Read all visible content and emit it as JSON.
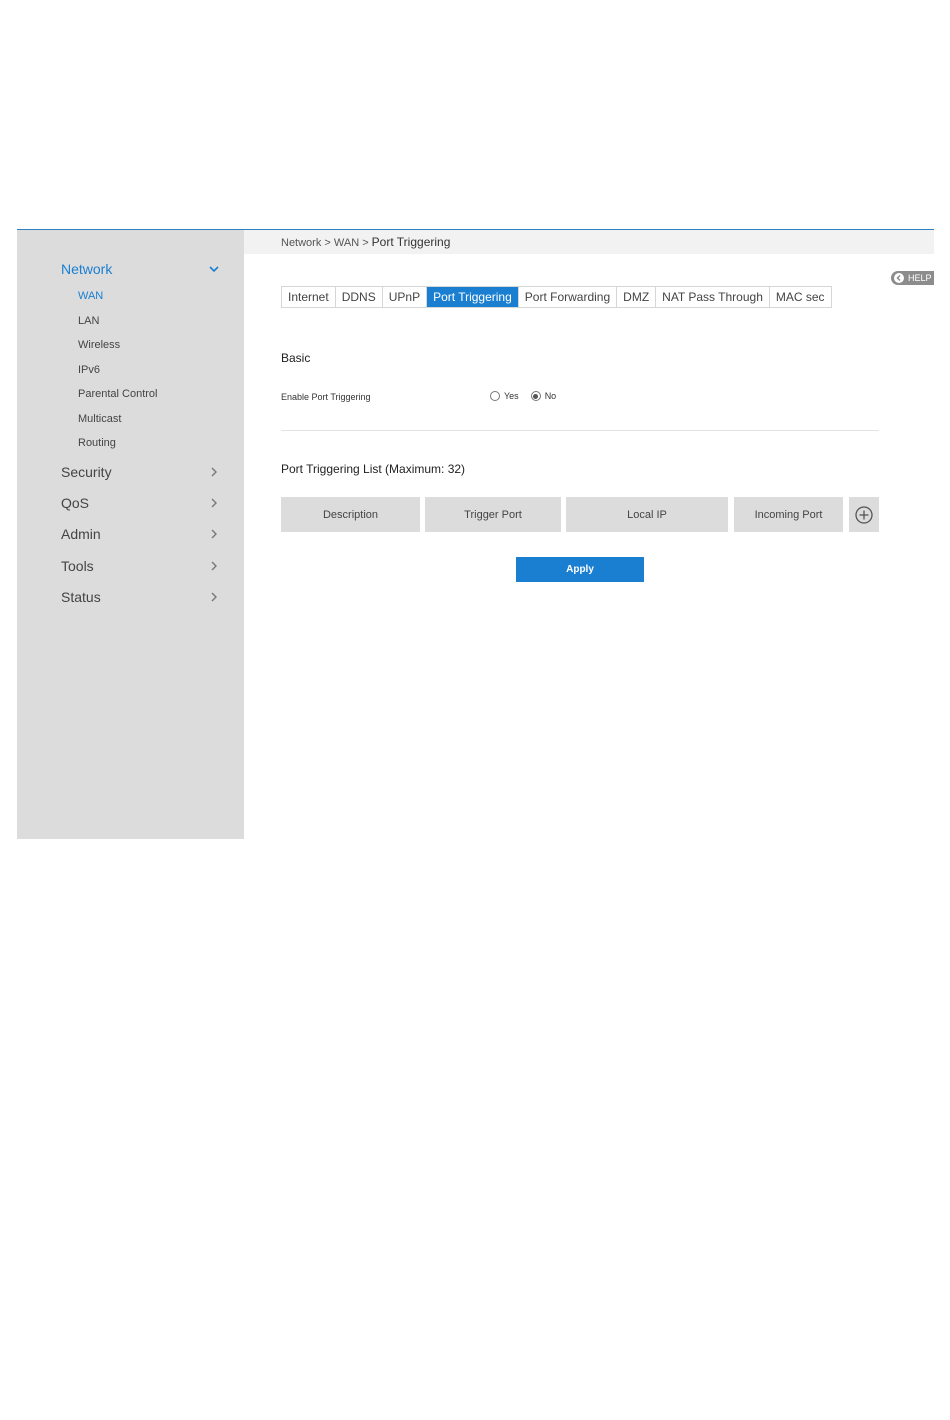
{
  "breadcrumb": {
    "path": "Network > WAN > ",
    "current": "Port Triggering"
  },
  "help": {
    "label": "HELP",
    "icon": "chevron-left-icon"
  },
  "sidebar": {
    "top_items": [
      {
        "label": "Network",
        "active": true,
        "icon": "chevron-down-icon"
      },
      {
        "label": "Security",
        "icon": "chevron-right-icon"
      },
      {
        "label": "QoS",
        "icon": "chevron-right-icon"
      },
      {
        "label": "Admin",
        "icon": "chevron-right-icon"
      },
      {
        "label": "Tools",
        "icon": "chevron-right-icon"
      },
      {
        "label": "Status",
        "icon": "chevron-right-icon"
      }
    ],
    "sub_items": [
      {
        "label": "WAN",
        "active": true
      },
      {
        "label": "LAN"
      },
      {
        "label": "Wireless"
      },
      {
        "label": "IPv6"
      },
      {
        "label": "Parental Control"
      },
      {
        "label": "Multicast"
      },
      {
        "label": "Routing"
      }
    ]
  },
  "tabs": [
    {
      "label": "Internet"
    },
    {
      "label": "DDNS"
    },
    {
      "label": "UPnP"
    },
    {
      "label": "Port Triggering",
      "active": true
    },
    {
      "label": "Port Forwarding"
    },
    {
      "label": "DMZ"
    },
    {
      "label": "NAT Pass Through"
    },
    {
      "label": "MAC sec"
    }
  ],
  "basic": {
    "title": "Basic",
    "enable_label": "Enable Port Triggering",
    "options": [
      {
        "label": "Yes",
        "selected": false
      },
      {
        "label": "No",
        "selected": true
      }
    ]
  },
  "list": {
    "title": "Port Triggering List (Maximum: 32)",
    "columns": [
      "Description",
      "Trigger Port",
      "Local IP",
      "Incoming Port"
    ],
    "add_icon": "plus-circle-icon"
  },
  "apply_label": "Apply",
  "colors": {
    "accent": "#1a7fd1",
    "sidebar_bg": "#dcdcdc",
    "header_bg": "#dcdcdc"
  }
}
